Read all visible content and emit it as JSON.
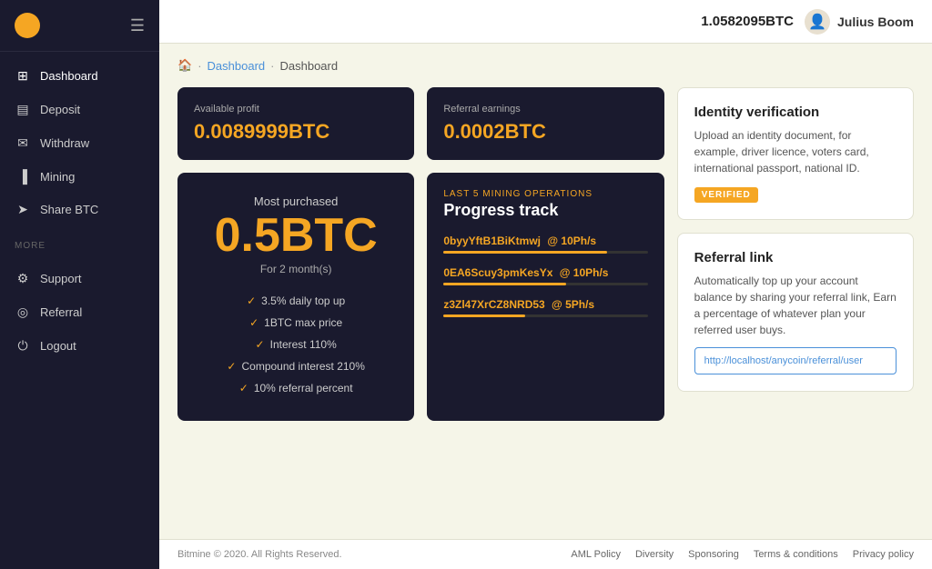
{
  "sidebar": {
    "logo_alt": "Bitmine Logo",
    "nav_main": [
      {
        "id": "dashboard",
        "label": "Dashboard",
        "icon": "🏠"
      },
      {
        "id": "deposit",
        "label": "Deposit",
        "icon": "💳"
      },
      {
        "id": "withdraw",
        "label": "Withdraw",
        "icon": "✉"
      },
      {
        "id": "mining",
        "label": "Mining",
        "icon": "📊"
      },
      {
        "id": "share-btc",
        "label": "Share BTC",
        "icon": "➤"
      }
    ],
    "more_label": "MORE",
    "nav_more": [
      {
        "id": "support",
        "label": "Support",
        "icon": "⚙"
      },
      {
        "id": "referral",
        "label": "Referral",
        "icon": "◎"
      },
      {
        "id": "logout",
        "label": "Logout",
        "icon": "⏻"
      }
    ]
  },
  "header": {
    "balance": "1.0582095BTC",
    "username": "Julius Boom"
  },
  "breadcrumb": {
    "home": "🏠",
    "sep1": "·",
    "link1": "Dashboard",
    "sep2": "·",
    "current": "Dashboard"
  },
  "stats": {
    "available_profit_label": "Available profit",
    "available_profit_value": "0.0089999BTC",
    "referral_earnings_label": "Referral earnings",
    "referral_earnings_value": "0.0002BTC"
  },
  "most_purchased": {
    "label": "Most purchased",
    "value": "0.5BTC",
    "duration": "For 2 month(s)",
    "features": [
      "3.5% daily top up",
      "1BTC max price",
      "Interest 110%",
      "Compound interest 210%",
      "10% referral percent"
    ]
  },
  "progress_track": {
    "subtitle": "LAST 5 MINING OPERATIONS",
    "title": "Progress track",
    "operations": [
      {
        "id": "0byyYftB1BiKtmwj",
        "speed": "@ 10Ph/s",
        "pct": 80
      },
      {
        "id": "0EA6Scuy3pmKesYx",
        "speed": "@ 10Ph/s",
        "pct": 60
      },
      {
        "id": "z3Zl47XrCZ8NRD53",
        "speed": "@ 5Ph/s",
        "pct": 40
      }
    ]
  },
  "identity": {
    "title": "Identity verification",
    "description": "Upload an identity document, for example, driver licence, voters card, international passport, national ID.",
    "badge": "VERIFIED"
  },
  "referral": {
    "title": "Referral link",
    "description": "Automatically top up your account balance by sharing your referral link, Earn a percentage of whatever plan your referred user buys.",
    "link": "http://localhost/anycoin/referral/user"
  },
  "footer": {
    "copyright": "Bitmine © 2020. All Rights Reserved.",
    "links": [
      {
        "label": "AML Policy",
        "href": "#"
      },
      {
        "label": "Diversity",
        "href": "#"
      },
      {
        "label": "Sponsoring",
        "href": "#"
      },
      {
        "label": "Terms & conditions",
        "href": "#"
      },
      {
        "label": "Privacy policy",
        "href": "#"
      }
    ]
  }
}
